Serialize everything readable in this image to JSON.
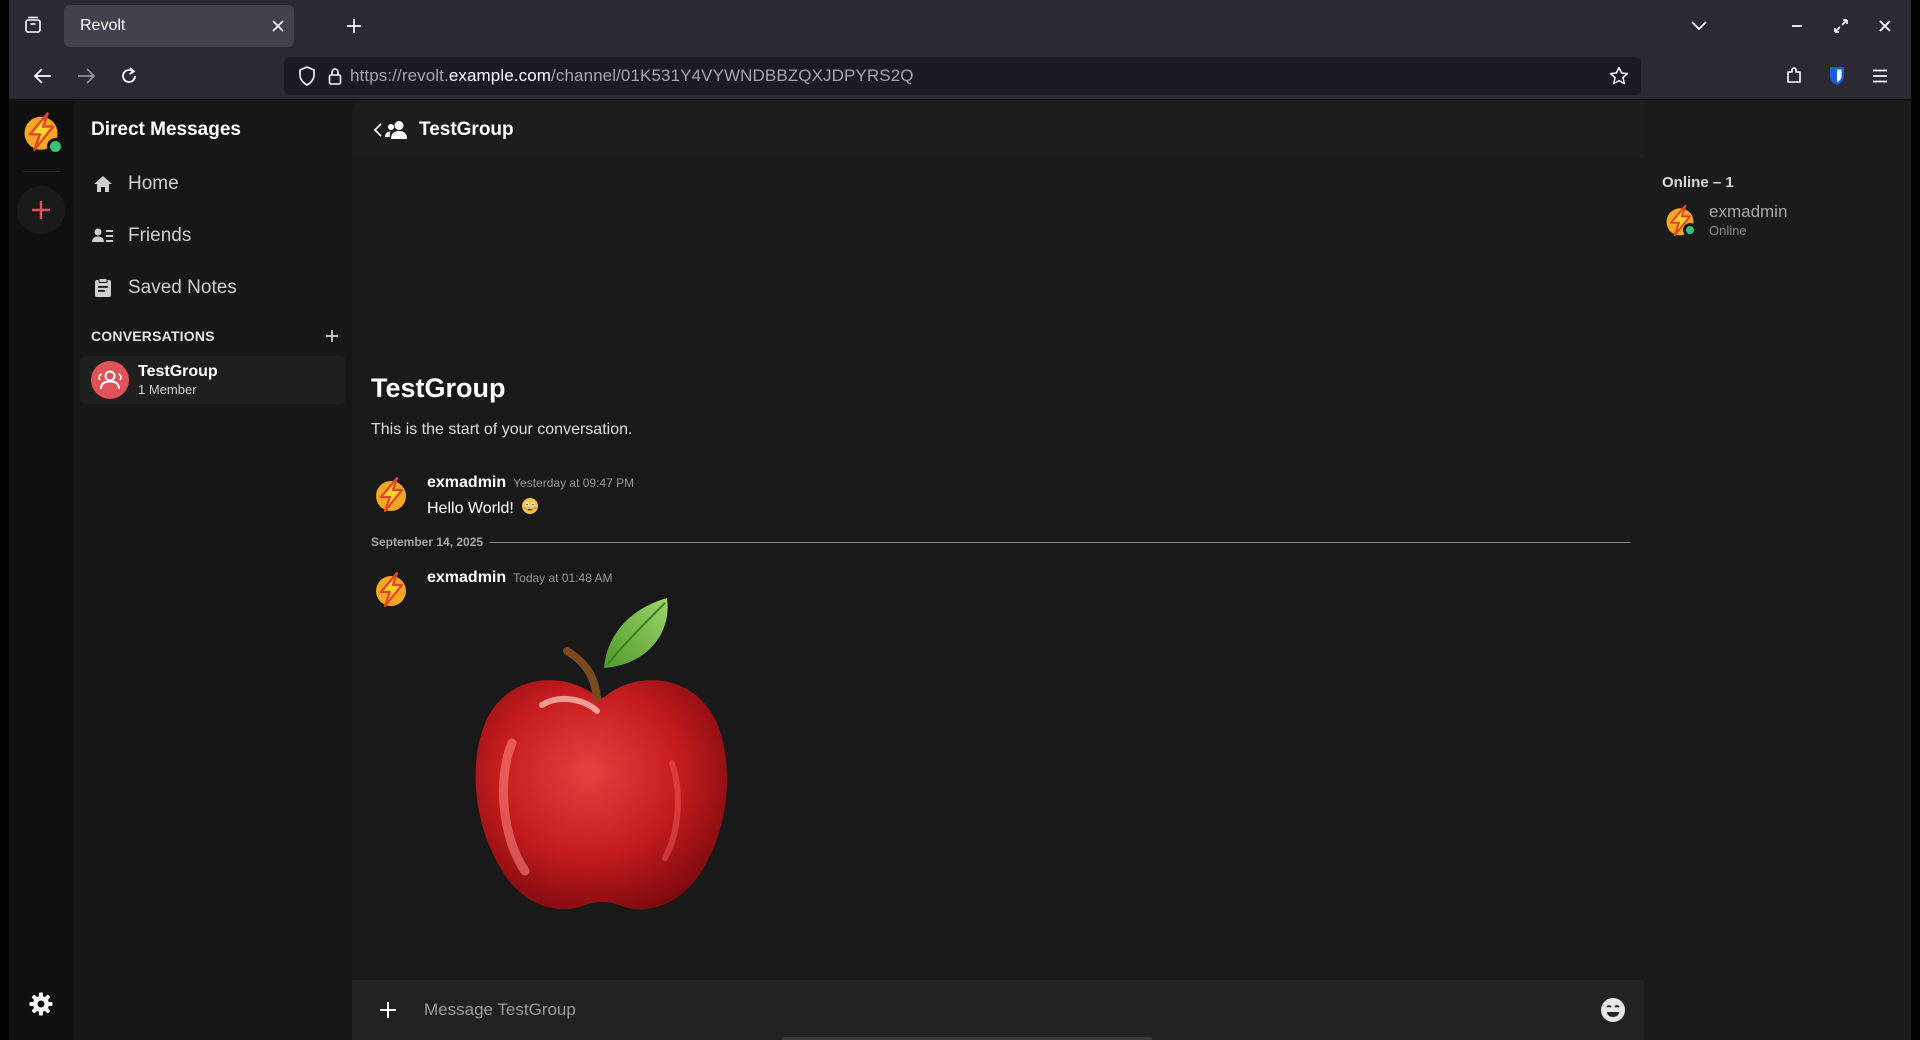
{
  "browser": {
    "tab_title": "Revolt",
    "url_prefix": "https://revolt.",
    "url_host": "example.com",
    "url_path": "/channel/01K531Y4VYWNDBBZQXJDPYRS2Q"
  },
  "sidebar": {
    "header": "Direct Messages",
    "links": [
      {
        "label": "Home",
        "icon": "home-icon"
      },
      {
        "label": "Friends",
        "icon": "friends-icon"
      },
      {
        "label": "Saved Notes",
        "icon": "notes-icon"
      }
    ],
    "section_label": "CONVERSATIONS",
    "conversations": [
      {
        "name": "TestGroup",
        "subtitle": "1 Member"
      }
    ]
  },
  "channel": {
    "title": "TestGroup",
    "start_title": "TestGroup",
    "start_subtitle": "This is the start of your conversation."
  },
  "messages": [
    {
      "user": "exmadmin",
      "time": "Yesterday at 09:47 PM",
      "text": "Hello World!",
      "emoji": "😳"
    },
    {
      "user": "exmadmin",
      "time": "Today at 01:48 AM",
      "text": "",
      "attachment": "apple-image"
    }
  ],
  "date_divider": "September 14, 2025",
  "composer": {
    "placeholder": "Message TestGroup"
  },
  "members": {
    "category": "Online – 1",
    "list": [
      {
        "name": "exmadmin",
        "status": "Online"
      }
    ]
  },
  "colors": {
    "accent": "#e05257",
    "online": "#3abf7e",
    "bitwarden": "#175ddc"
  }
}
